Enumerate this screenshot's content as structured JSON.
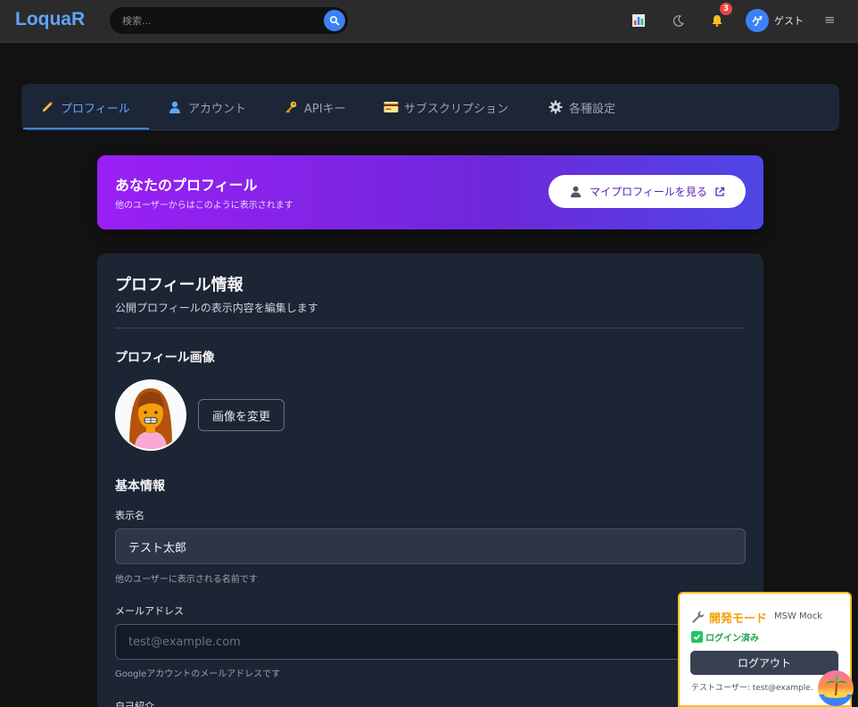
{
  "header": {
    "logo": "LoquaR",
    "search_placeholder": "検索...",
    "notification_count": "3",
    "avatar_initial": "ゲ",
    "user_name": "ゲスト",
    "menu_glyph": "≡"
  },
  "tabs": [
    {
      "label": "プロフィール",
      "icon": "pencil-icon",
      "active": true
    },
    {
      "label": "アカウント",
      "icon": "user-icon",
      "active": false
    },
    {
      "label": "APIキー",
      "icon": "key-icon",
      "active": false
    },
    {
      "label": "サブスクリプション",
      "icon": "credit-card-icon",
      "active": false
    },
    {
      "label": "各種設定",
      "icon": "gear-icon",
      "active": false
    }
  ],
  "banner": {
    "title": "あなたのプロフィール",
    "subtitle": "他のユーザーからはこのように表示されます",
    "button_label": "マイプロフィールを見る"
  },
  "profile_card": {
    "title": "プロフィール情報",
    "subtitle": "公開プロフィールの表示内容を編集します",
    "image_section_title": "プロフィール画像",
    "change_image_button": "画像を変更",
    "basic_section_title": "基本情報",
    "display_name": {
      "label": "表示名",
      "value": "テスト太郎",
      "help": "他のユーザーに表示される名前です"
    },
    "email": {
      "label": "メールアドレス",
      "placeholder": "test@example.com",
      "help": "Googleアカウントのメールアドレスです"
    },
    "bio_label": "自己紹介"
  },
  "dev_panel": {
    "title": "開発モード",
    "mock_label": "MSW Mock",
    "status": "ログイン済み",
    "logout_button": "ログアウト",
    "test_user": "テストユーザー: test@example."
  },
  "colors": {
    "accent": "#3b82f6",
    "header_bg": "#2b2b2b",
    "card_bg": "#1c2533",
    "banner_from": "#9b1ff5",
    "banner_to": "#4f46e5",
    "dev_border": "#fbbf24"
  }
}
